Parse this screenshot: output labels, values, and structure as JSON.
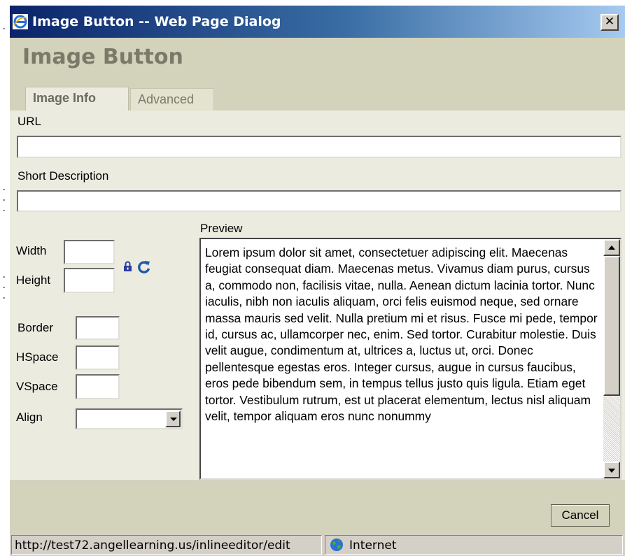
{
  "window": {
    "title": "Image Button -- Web Page Dialog",
    "close_glyph": "✕"
  },
  "dialog": {
    "heading": "Image Button",
    "tabs": [
      {
        "label": "Image Info",
        "active": true
      },
      {
        "label": "Advanced",
        "active": false
      }
    ]
  },
  "form": {
    "url_label": "URL",
    "url_value": "",
    "short_description_label": "Short Description",
    "short_description_value": "",
    "width_label": "Width",
    "width_value": "",
    "height_label": "Height",
    "height_value": "",
    "border_label": "Border",
    "border_value": "",
    "hspace_label": "HSpace",
    "hspace_value": "",
    "vspace_label": "VSpace",
    "vspace_value": "",
    "align_label": "Align",
    "align_value": ""
  },
  "preview": {
    "label": "Preview",
    "text": "Lorem ipsum dolor sit amet, consectetuer adipiscing elit. Maecenas feugiat consequat diam. Maecenas metus. Vivamus diam purus, cursus a, commodo non, facilisis vitae, nulla. Aenean dictum lacinia tortor. Nunc iaculis, nibh non iaculis aliquam, orci felis euismod neque, sed ornare massa mauris sed velit. Nulla pretium mi et risus. Fusce mi pede, tempor id, cursus ac, ullamcorper nec, enim. Sed tortor. Curabitur molestie. Duis velit augue, condimentum at, ultrices a, luctus ut, orci. Donec pellentesque egestas eros. Integer cursus, augue in cursus faucibus, eros pede bibendum sem, in tempus tellus justo quis ligula. Etiam eget tortor. Vestibulum rutrum, est ut placerat elementum, lectus nisl aliquam velit, tempor aliquam eros nunc nonummy"
  },
  "footer": {
    "cancel_label": "Cancel"
  },
  "statusbar": {
    "url": "http://test72.angellearning.us/inlineeditor/edit",
    "zone": "Internet"
  },
  "icons": {
    "app": "ie-icon",
    "lock": "lock-icon",
    "reset": "reset-size-icon",
    "globe": "globe-icon"
  },
  "colors": {
    "titlebar_start": "#0a246a",
    "titlebar_end": "#a6caf0",
    "header_bg": "#d2d3ba",
    "body_bg": "#ecebe0",
    "heading_text": "#7a7a69",
    "lock": "#2b3d9e",
    "reset": "#1f5aa8"
  }
}
